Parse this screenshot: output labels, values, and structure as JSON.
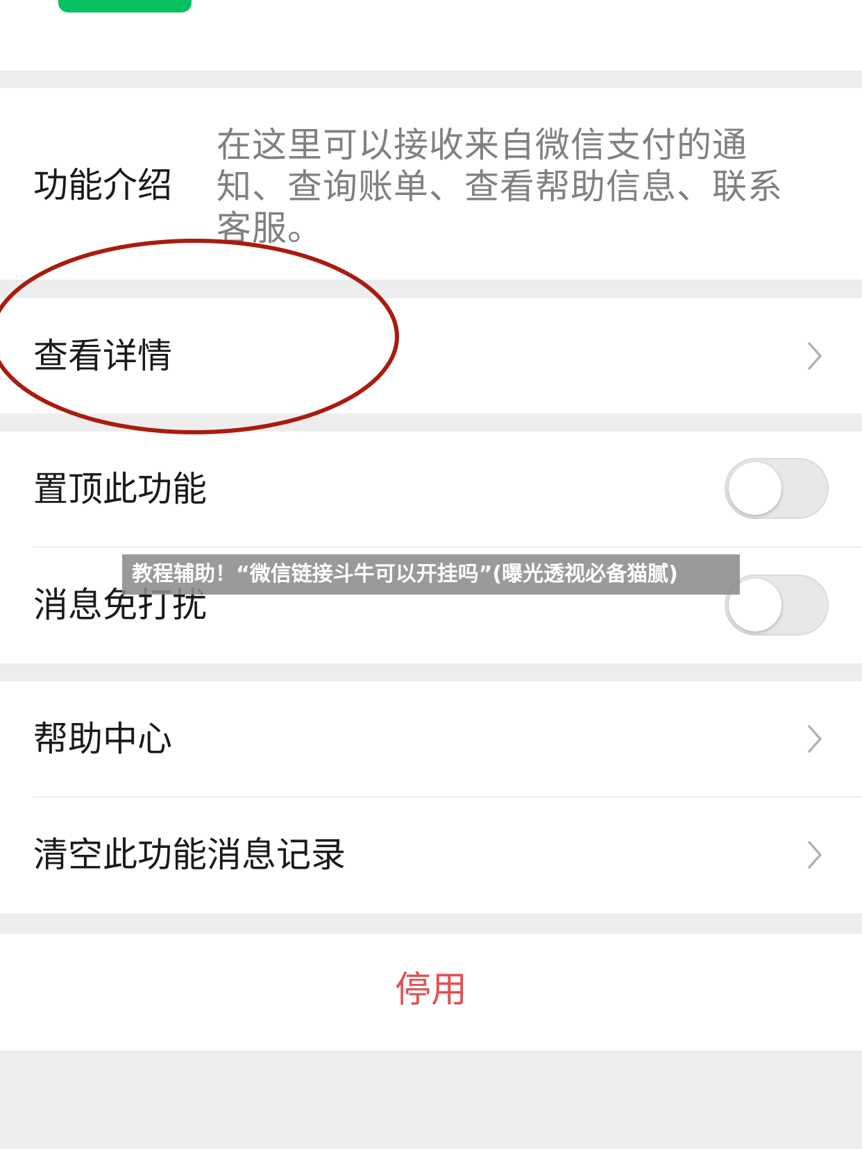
{
  "intro": {
    "label": "功能介绍",
    "description": "在这里可以接收来自微信支付的通知、查询账单、查看帮助信息、联系客服。"
  },
  "details": {
    "label": "查看详情",
    "icon": "chevron-right-icon"
  },
  "pin": {
    "label": "置顶此功能",
    "state": "off"
  },
  "mute": {
    "label": "消息免打扰",
    "state": "off"
  },
  "help": {
    "label": "帮助中心",
    "icon": "chevron-right-icon"
  },
  "clear": {
    "label": "清空此功能消息记录",
    "icon": "chevron-right-icon"
  },
  "disable": {
    "label": "停用",
    "color": "#e05252"
  },
  "overlay": {
    "watermark": "教程辅助！“微信链接斗牛可以开挂吗”(曝光透视必备猫腻)"
  },
  "colors": {
    "accent_green": "#07c160",
    "annotation_red": "#a81c10"
  }
}
